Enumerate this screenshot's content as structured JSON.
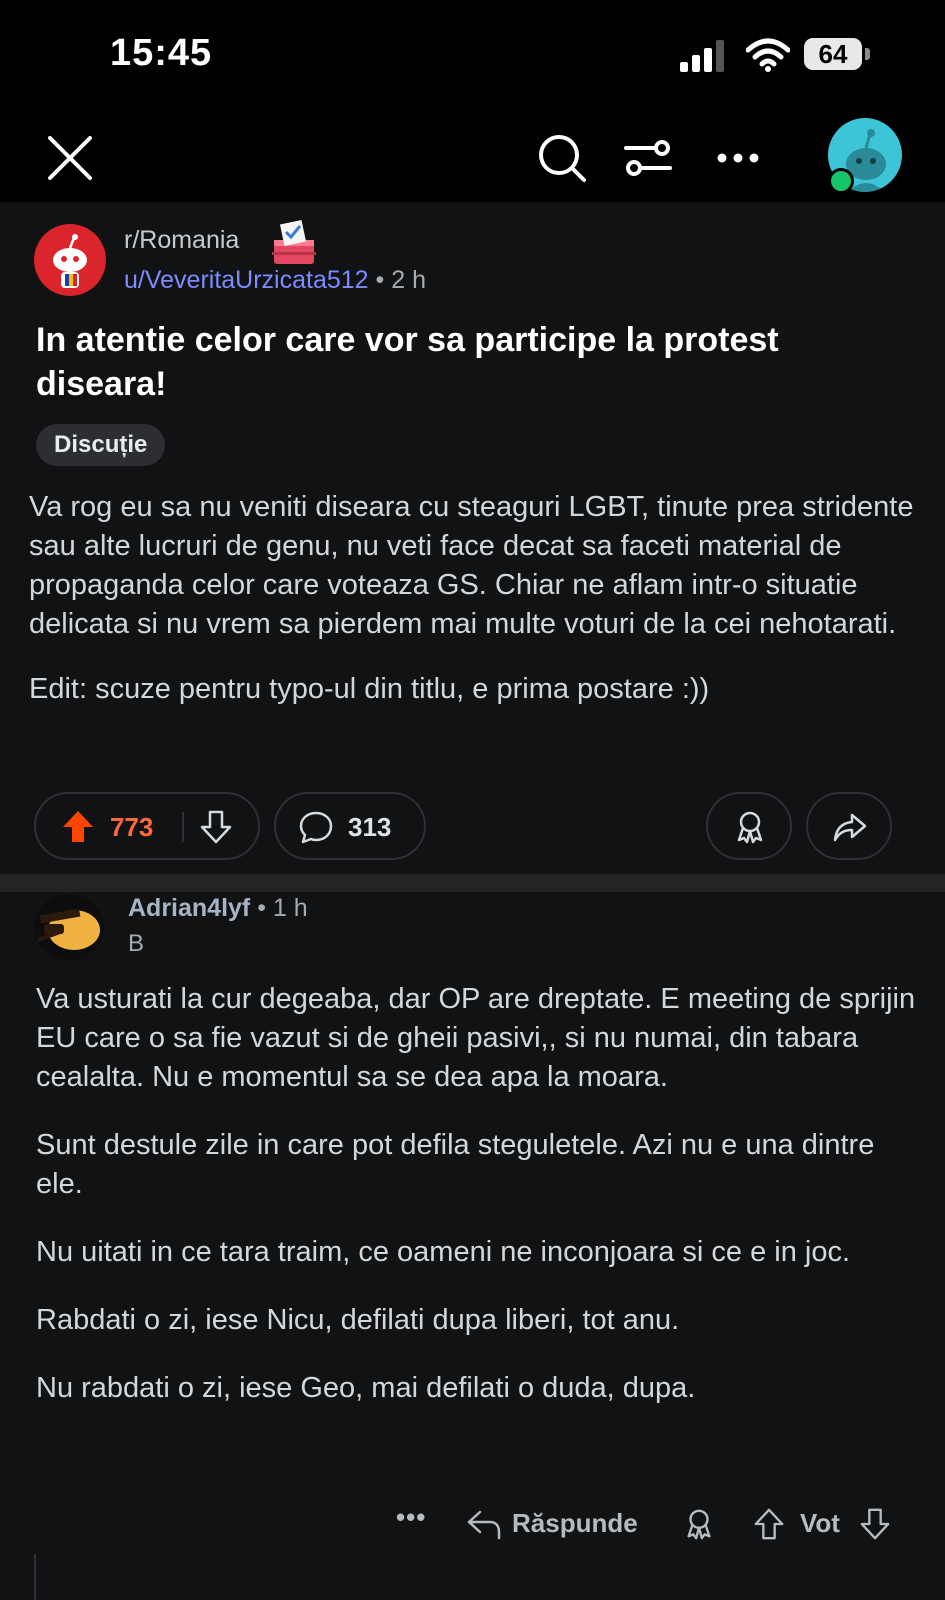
{
  "status_bar": {
    "time": "15:45",
    "battery": "64"
  },
  "nav": {
    "close": "close",
    "search": "search",
    "filters": "filters",
    "more": "more",
    "profile": "profile"
  },
  "post": {
    "subreddit": "r/Romania",
    "author": "u/VeveritaUrzicata512",
    "separator": "•",
    "age": "2 h",
    "title": "In atentie celor care vor sa participe la protest diseara!",
    "flair": "Discuție",
    "body": [
      "Va rog eu sa nu veniti diseara cu steaguri LGBT, tinute prea stridente sau alte lucruri de genu, nu veti face decat sa faceti material de propaganda celor care voteaza GS. Chiar ne aflam intr-o situatie delicata si nu vrem sa pierdem mai multe voturi de la cei nehotarati.",
      "Edit: scuze pentru typo-ul din titlu, e prima postare :))"
    ],
    "upvotes": "773",
    "comments": "313"
  },
  "comment": {
    "author": "Adrian4lyf",
    "separator": "•",
    "age": "1 h",
    "flair": "B",
    "body": [
      "Va usturati la cur degeaba, dar OP are dreptate. E meeting de sprijin EU care o sa fie vazut si de gheii pasivi,, si nu numai, din tabara cealalta. Nu e momentul sa se dea apa la moara.",
      "Sunt destule zile in care pot defila steguletele. Azi nu e una dintre ele.",
      "Nu uitati in ce tara traim, ce oameni ne inconjoara si ce e in joc.",
      "Rabdati o zi, iese Nicu, defilati dupa liberi, tot anu.",
      "Nu rabdati o zi, iese Geo, mai defilati o duda, dupa."
    ],
    "more": "•••",
    "reply_label": "Răspunde",
    "vote_label": "Vot"
  },
  "colors": {
    "upvote": "#ff4500",
    "username": "#7c8bff",
    "background": "#111214"
  }
}
